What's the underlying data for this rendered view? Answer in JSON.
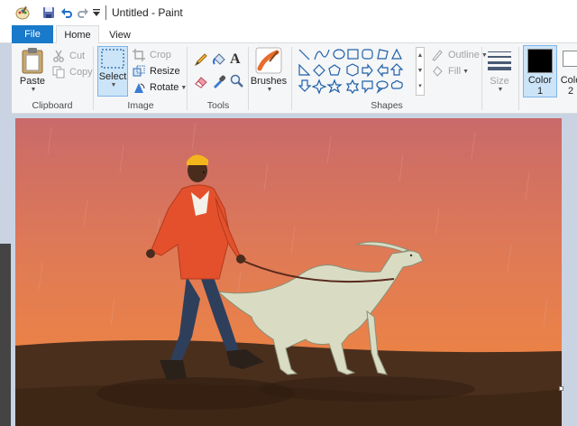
{
  "window": {
    "title": "Untitled - Paint"
  },
  "quick_access": [
    "paint-app-icon",
    "save-icon",
    "undo-icon",
    "redo-icon",
    "customize-dropdown-icon"
  ],
  "tabs": {
    "file": "File",
    "home": "Home",
    "view": "View"
  },
  "ribbon": {
    "clipboard": {
      "label": "Clipboard",
      "paste": "Paste",
      "cut": "Cut",
      "copy": "Copy"
    },
    "image": {
      "label": "Image",
      "select": "Select",
      "crop": "Crop",
      "resize": "Resize",
      "rotate": "Rotate"
    },
    "tools": {
      "label": "Tools",
      "items": [
        "pencil-icon",
        "fill-bucket-icon",
        "text-icon",
        "eraser-icon",
        "color-picker-icon",
        "magnifier-icon"
      ]
    },
    "brushes": {
      "label": "Brushes"
    },
    "shapes": {
      "label": "Shapes",
      "outline": "Outline",
      "fill": "Fill"
    },
    "size": {
      "label": "Size"
    },
    "colors": {
      "color1_label": "Color",
      "color1_num": "1",
      "color2_label": "Colo",
      "color2_num": "2",
      "color1_hex": "#000000",
      "color2_hex": "#ffffff"
    }
  },
  "accent_color": "#1979ca",
  "canvas": {
    "content": "illustration of a person walking a pale dinosaur on a leash at sunset"
  }
}
